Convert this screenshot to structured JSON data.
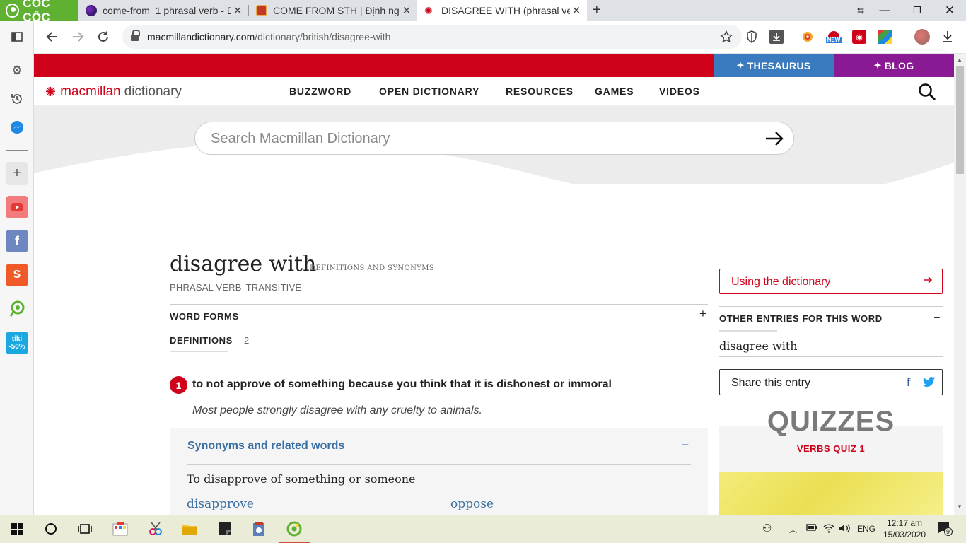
{
  "browser": {
    "brand": "CỐC CỐC",
    "tabs": [
      {
        "title": "come-from_1 phrasal verb - D",
        "close": "✕"
      },
      {
        "title": "COME FROM STH | Định nghĩ",
        "close": "✕"
      },
      {
        "title": "DISAGREE WITH (phrasal verb",
        "close": "✕"
      }
    ],
    "new_tab": "+",
    "url_domain": "macmillandictionary.com",
    "url_path": "/dictionary/british/disagree-with",
    "ext_new_badge": "NEW"
  },
  "site": {
    "thesaurus": "THESAURUS",
    "blog": "BLOG",
    "logo_part1": "macmillan",
    "logo_part2": "dictionary",
    "nav": [
      "BUZZWORD",
      "OPEN DICTIONARY",
      "RESOURCES",
      "GAMES",
      "VIDEOS"
    ],
    "search_placeholder": "Search Macmillan Dictionary"
  },
  "entry": {
    "headword": "disagree with",
    "defs_and_syn": "DEFINITIONS AND SYNONYMS",
    "pos": [
      "PHRASAL VERB",
      "TRANSITIVE"
    ],
    "word_forms": "WORD FORMS",
    "word_forms_toggle": "+",
    "definitions_tab": "DEFINITIONS",
    "definitions_count": "2",
    "sense": {
      "number": "1",
      "definition": "to not approve of something because you think that it is dishonest or immoral",
      "example": "Most people strongly disagree with any cruelty to animals."
    },
    "synonyms": {
      "title": "Synonyms and related words",
      "toggle": "–",
      "subtitle": "To disapprove of something or someone",
      "words": [
        "disapprove",
        "oppose"
      ]
    }
  },
  "sidebar_right": {
    "using_dictionary": "Using the dictionary",
    "other_entries_title": "OTHER ENTRIES FOR THIS WORD",
    "other_entries_toggle": "–",
    "other_entry": "disagree with",
    "share": "Share this entry",
    "facebook_glyph": "f",
    "quizzes": "QUIZZES",
    "verbs_quiz": "VERBS QUIZ 1"
  },
  "taskbar": {
    "language": "ENG",
    "time": "12:17 am",
    "date": "15/03/2020",
    "notifications": "9"
  },
  "colors": {
    "brand_red": "#d0021b",
    "thesaurus_blue": "#3a7bbf",
    "blog_purple": "#8a1a94",
    "browser_green": "#5fb132",
    "link_blue": "#3a6fa3"
  },
  "icons": [
    "search-icon",
    "arrow-right-icon",
    "lock-icon",
    "star-icon",
    "shield-icon",
    "download-icon",
    "settings-icon",
    "history-icon",
    "messenger-icon",
    "youtube-icon",
    "facebook-icon",
    "twitter-icon",
    "windows-start-icon"
  ]
}
